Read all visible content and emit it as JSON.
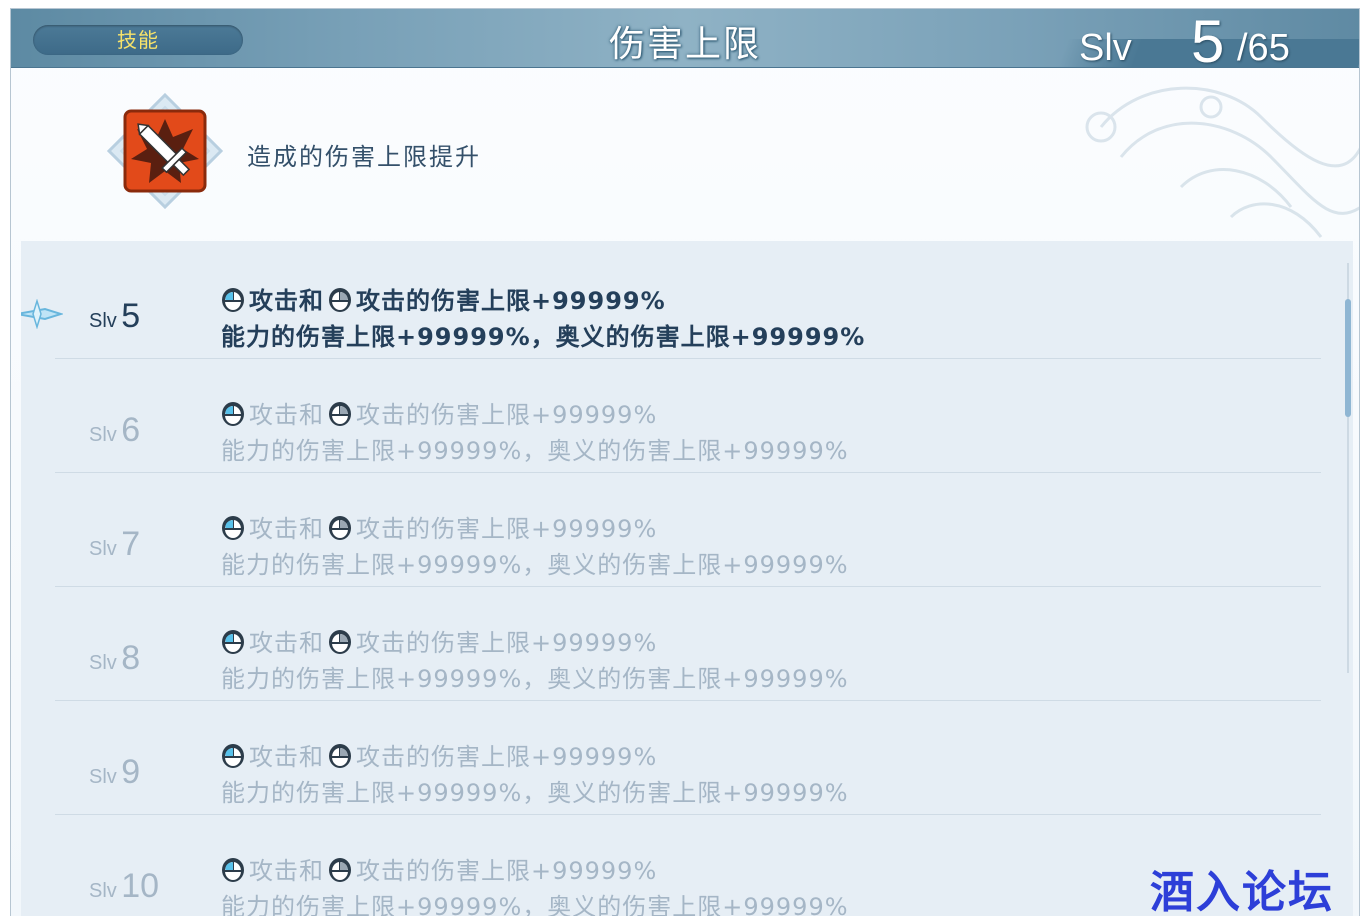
{
  "header": {
    "tab_label": "技能",
    "title": "伤害上限",
    "level_label": "Slv",
    "level_current": "5",
    "level_max": "/65"
  },
  "skill": {
    "icon": "sword-burst-icon",
    "description": "造成的伤害上限提升"
  },
  "levels": [
    {
      "prefix": "Slv",
      "num": "5",
      "line1": "攻击和",
      "line1b": "攻击的伤害上限+99999%",
      "line2": "能力的伤害上限+99999%，奥义的伤害上限+99999%"
    },
    {
      "prefix": "Slv",
      "num": "6",
      "line1": "攻击和",
      "line1b": "攻击的伤害上限+99999%",
      "line2": "能力的伤害上限+99999%，奥义的伤害上限+99999%"
    },
    {
      "prefix": "Slv",
      "num": "7",
      "line1": "攻击和",
      "line1b": "攻击的伤害上限+99999%",
      "line2": "能力的伤害上限+99999%，奥义的伤害上限+99999%"
    },
    {
      "prefix": "Slv",
      "num": "8",
      "line1": "攻击和",
      "line1b": "攻击的伤害上限+99999%",
      "line2": "能力的伤害上限+99999%，奥义的伤害上限+99999%"
    },
    {
      "prefix": "Slv",
      "num": "9",
      "line1": "攻击和",
      "line1b": "攻击的伤害上限+99999%",
      "line2": "能力的伤害上限+99999%，奥义的伤害上限+99999%"
    },
    {
      "prefix": "Slv",
      "num": "10",
      "line1": "攻击和",
      "line1b": "攻击的伤害上限+99999%",
      "line2": "能力的伤害上限+99999%，奥义的伤害上限+99999%"
    }
  ],
  "active_index": 0,
  "watermark": "酒入论坛",
  "colors": {
    "header": "#78a0b7",
    "tag_text": "#f7e36a",
    "active_text": "#243f5a",
    "dim_text": "#a5b6c6",
    "icon_bg": "#e24a1a"
  }
}
